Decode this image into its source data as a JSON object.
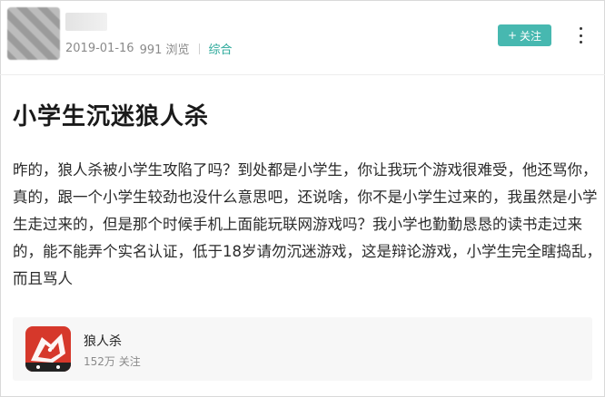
{
  "post": {
    "date": "2019-01-16",
    "views": "991 浏览",
    "category": "综合",
    "follow_label": "关注",
    "title": "小学生沉迷狼人杀",
    "body_lines": [
      "昨的，狼人杀被小学生攻陷了吗？到处都是小学生，你让我玩个游戏很难受，他还骂你，",
      "真的，跟一个小学生较劲也没什么意思吧，还说啥，你不是小学生过来的，我虽然是小学",
      "生走过来的，但是那个时候手机上面能玩联网游戏吗？我小学也勤勤恳恳的读书走过来",
      "的，能不能弄个实名认证，低于18岁请勿沉迷游戏，这是辩论游戏，小学生完全瞎捣乱，",
      "而且骂人"
    ]
  },
  "app_card": {
    "name": "狼人杀",
    "followers": "152万 关注",
    "icon": "werewolf-game-icon"
  },
  "colors": {
    "accent": "#47b8b0",
    "tag": "#2aa89a",
    "app_icon_bg": "#d6382b"
  }
}
